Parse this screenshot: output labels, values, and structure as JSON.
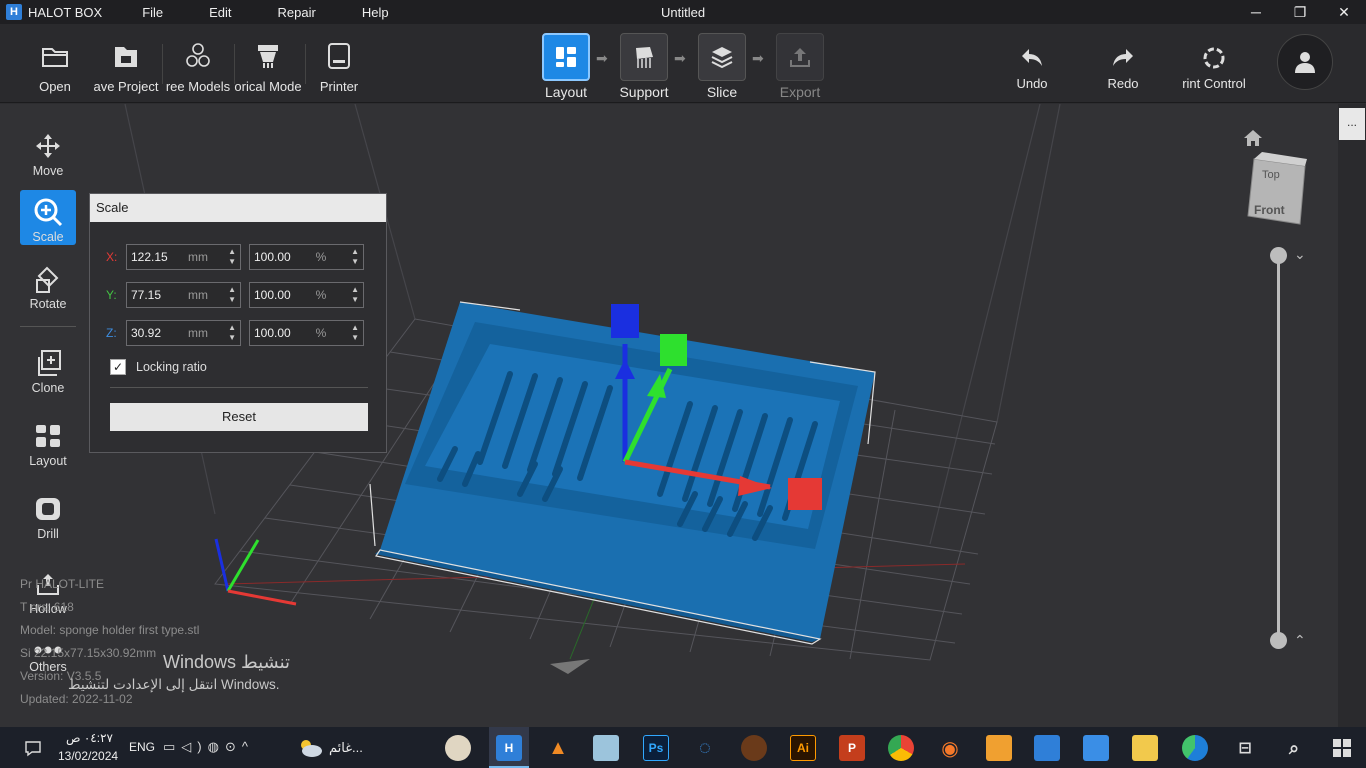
{
  "app": {
    "name": "HALOT BOX",
    "window_title": "Untitled",
    "menu": [
      "File",
      "Edit",
      "Repair",
      "Help"
    ],
    "window_controls": [
      "─",
      "❐",
      "✕"
    ]
  },
  "toolbar": {
    "open": "Open",
    "save_project": "ave Project",
    "free_models": "ree Models",
    "historical_models": "orical Mode",
    "printer": "Printer",
    "steps": [
      "Layout",
      "Support",
      "Slice",
      "Export"
    ],
    "undo": "Undo",
    "redo": "Redo",
    "print_control": "rint Control"
  },
  "left_tools": [
    "Move",
    "Scale",
    "Rotate",
    "Clone",
    "Layout",
    "Drill",
    "Hollow",
    "Others"
  ],
  "scale_panel": {
    "title": "Scale",
    "rows": [
      {
        "axis": "X:",
        "axis_color": "#e53935",
        "size": "122.15",
        "size_unit": "mm",
        "percent": "100.00",
        "percent_unit": "%"
      },
      {
        "axis": "Y:",
        "axis_color": "#43c243",
        "size": "77.15",
        "size_unit": "mm",
        "percent": "100.00",
        "percent_unit": "%"
      },
      {
        "axis": "Z:",
        "axis_color": "#3d8de0",
        "size": "30.92",
        "size_unit": "mm",
        "percent": "100.00",
        "percent_unit": "%"
      }
    ],
    "locking_ratio": "Locking ratio",
    "locking_checked": "✓",
    "reset": "Reset"
  },
  "info": {
    "printer": "Pr      HALOT-LITE",
    "triangles": "T           ors: 618",
    "model": "Model: sponge holder first type.stl",
    "size": "Si   22.15x77.15x30.92mm",
    "version": "Version: V3.5.5",
    "updated": "Updated:  2022-11-02"
  },
  "activation": {
    "line1": "Windows تنشيط",
    "line2": "انتقل إلى الإعدادت لتنشيط Windows."
  },
  "view_cube": {
    "top": "Top",
    "front": "Front"
  },
  "right_strip": {
    "more": "..."
  },
  "taskbar": {
    "time": "٠٤:٢٧ ص",
    "date": "13/02/2024",
    "lang": "ENG",
    "weather": "غائم...",
    "apps": [
      "Ps",
      "Ai",
      "P"
    ]
  },
  "colors": {
    "accent": "#1e88e5",
    "model": "#1a6fb0",
    "x_axis": "#e53935",
    "y_axis": "#43c243",
    "z_axis": "#1a2fe0"
  }
}
